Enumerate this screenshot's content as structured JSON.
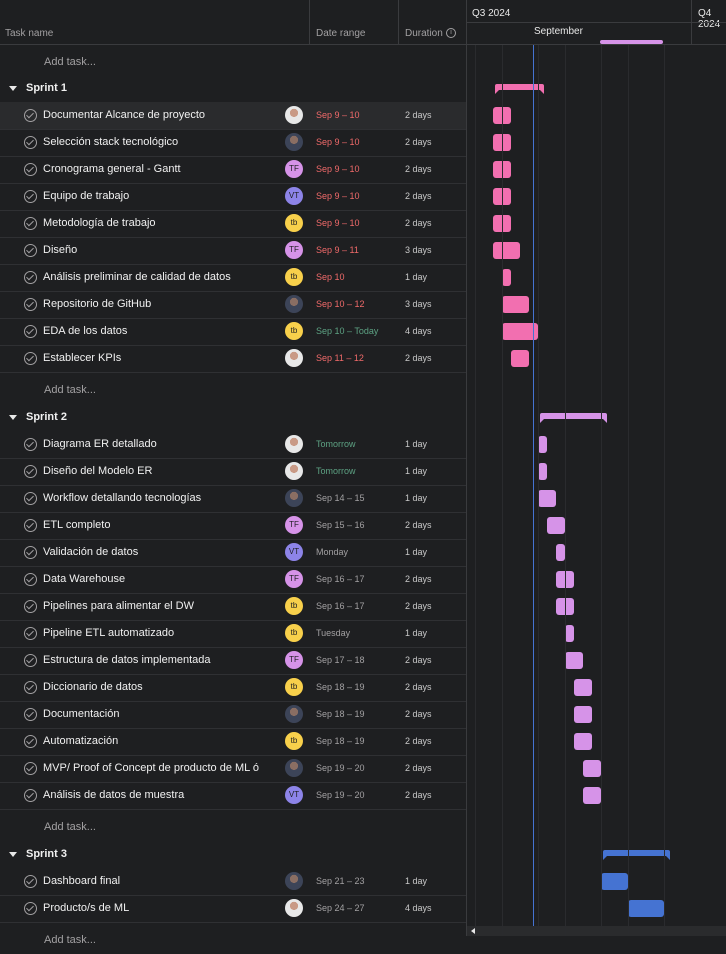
{
  "colors": {
    "overdue": "#f06a6a",
    "ontrack": "#5da283",
    "normal": "#a2a0a2",
    "sprint1": "#f26fb0",
    "sprint2": "#d693e8",
    "sprint3": "#4573d2"
  },
  "header": {
    "task_name": "Task name",
    "date_range": "Date range",
    "duration": "Duration",
    "info_icon": "info-icon"
  },
  "timeline": {
    "q3": "Q3 2024",
    "q4": "Q4 2024",
    "month": "September"
  },
  "sections": [
    {
      "name": "Sprint 1",
      "color": "#f26fb0",
      "tasks": [
        {
          "name": "Documentar Alcance de proyecto",
          "avatar": "photo",
          "date": "Sep 9 – 10",
          "status": "overdue",
          "duration": "2 days"
        },
        {
          "name": "Selección stack tecnológico",
          "avatar": "photo2",
          "date": "Sep 9 – 10",
          "status": "overdue",
          "duration": "2 days"
        },
        {
          "name": "Cronograma general - Gantt",
          "avatar": "TF",
          "date": "Sep 9 – 10",
          "status": "overdue",
          "duration": "2 days"
        },
        {
          "name": "Equipo de trabajo",
          "avatar": "VT",
          "date": "Sep 9 – 10",
          "status": "overdue",
          "duration": "2 days"
        },
        {
          "name": "Metodología de trabajo",
          "avatar": "tb",
          "date": "Sep 9 – 10",
          "status": "overdue",
          "duration": "2 days"
        },
        {
          "name": "Diseño",
          "avatar": "TF",
          "date": "Sep 9 – 11",
          "status": "overdue",
          "duration": "3 days"
        },
        {
          "name": "Análisis preliminar de calidad de datos",
          "avatar": "tb",
          "date": "Sep 10",
          "status": "overdue",
          "duration": "1 day"
        },
        {
          "name": "Repositorio de GitHub",
          "avatar": "photo2",
          "date": "Sep 10 – 12",
          "status": "overdue",
          "duration": "3 days"
        },
        {
          "name": "EDA de los datos",
          "avatar": "tb",
          "date": "Sep 10 – Today",
          "status": "ontrack",
          "duration": "4 days"
        },
        {
          "name": "Establecer KPIs",
          "avatar": "photo",
          "date": "Sep 11 – 12",
          "status": "overdue",
          "duration": "2 days"
        }
      ]
    },
    {
      "name": "Sprint 2",
      "color": "#d693e8",
      "tasks": [
        {
          "name": "Diagrama ER detallado",
          "avatar": "photo",
          "date": "Tomorrow",
          "status": "ontrack",
          "duration": "1 day"
        },
        {
          "name": "Diseño del Modelo ER",
          "avatar": "photo",
          "date": "Tomorrow",
          "status": "ontrack",
          "duration": "1 day"
        },
        {
          "name": "Workflow detallando tecnologías",
          "avatar": "photo2",
          "date": "Sep 14 – 15",
          "status": "normal",
          "duration": "1 day"
        },
        {
          "name": "ETL completo",
          "avatar": "TF",
          "date": "Sep 15 – 16",
          "status": "normal",
          "duration": "2 days"
        },
        {
          "name": "Validación de datos",
          "avatar": "VT",
          "date": "Monday",
          "status": "normal",
          "duration": "1 day"
        },
        {
          "name": "Data Warehouse",
          "avatar": "TF",
          "date": "Sep 16 – 17",
          "status": "normal",
          "duration": "2 days"
        },
        {
          "name": "Pipelines para alimentar el DW",
          "avatar": "tb",
          "date": "Sep 16 – 17",
          "status": "normal",
          "duration": "2 days"
        },
        {
          "name": "Pipeline ETL automatizado",
          "avatar": "tb",
          "date": "Tuesday",
          "status": "normal",
          "duration": "1 day"
        },
        {
          "name": "Estructura de datos implementada",
          "avatar": "TF",
          "date": "Sep 17 – 18",
          "status": "normal",
          "duration": "2 days"
        },
        {
          "name": "Diccionario de datos",
          "avatar": "tb",
          "date": "Sep 18 – 19",
          "status": "normal",
          "duration": "2 days"
        },
        {
          "name": "Documentación",
          "avatar": "photo2",
          "date": "Sep 18 – 19",
          "status": "normal",
          "duration": "2 days"
        },
        {
          "name": "Automatización",
          "avatar": "tb",
          "date": "Sep 18 – 19",
          "status": "normal",
          "duration": "2 days"
        },
        {
          "name": "MVP/ Proof of Concept de producto de ML ó",
          "avatar": "photo2",
          "date": "Sep 19 – 20",
          "status": "normal",
          "duration": "2 days"
        },
        {
          "name": "Análisis de datos de muestra",
          "avatar": "VT",
          "date": "Sep 19 – 20",
          "status": "normal",
          "duration": "2 days"
        }
      ]
    },
    {
      "name": "Sprint 3",
      "color": "#4573d2",
      "tasks": [
        {
          "name": "Dashboard final",
          "avatar": "photo2",
          "date": "Sep 21 – 23",
          "status": "normal",
          "duration": "1 day"
        },
        {
          "name": "Producto/s de ML",
          "avatar": "photo",
          "date": "Sep 24 – 27",
          "status": "normal",
          "duration": "4 days"
        }
      ]
    }
  ],
  "add_task": "Add task..."
}
